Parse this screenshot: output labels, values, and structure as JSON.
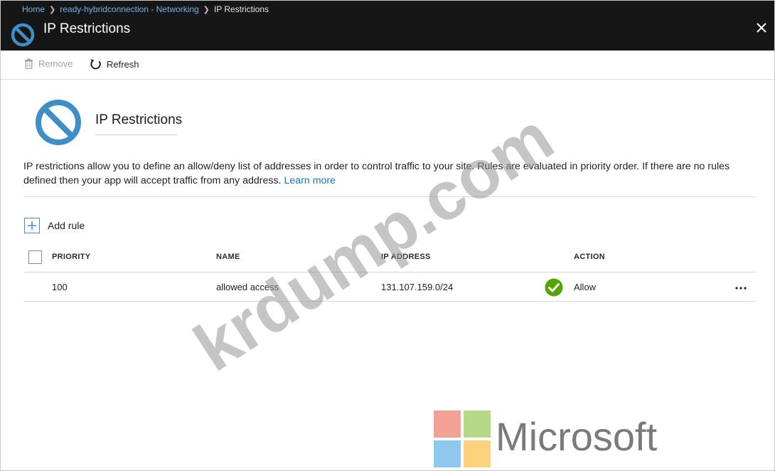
{
  "breadcrumb": {
    "home": "Home",
    "parent": "ready-hybridconnection - Networking",
    "current": "IP Restrictions"
  },
  "blade": {
    "title": "IP Restrictions",
    "icon": "blocked-circle-icon",
    "close_icon": "close-icon"
  },
  "toolbar": {
    "remove_label": "Remove",
    "remove_icon": "trash-icon",
    "refresh_label": "Refresh",
    "refresh_icon": "refresh-icon"
  },
  "content": {
    "title": "IP Restrictions",
    "description": "IP restrictions allow you to define an allow/deny list of addresses in order to control traffic to your site. Rules are evaluated in priority order. If there are no rules defined then your app will accept traffic from any address.",
    "learn_more": "Learn more"
  },
  "add_rule": {
    "label": "Add rule",
    "icon": "plus-icon"
  },
  "table": {
    "columns": {
      "priority": "PRIORITY",
      "name": "NAME",
      "ip_address": "IP ADDRESS",
      "action": "ACTION"
    },
    "rows": [
      {
        "priority": "100",
        "name": "allowed access",
        "ip_address": "131.107.159.0/24",
        "action": "Allow",
        "action_icon": "check-circle-icon"
      }
    ]
  },
  "watermark": {
    "text": "krdump.com",
    "logo_text": "Microsoft"
  },
  "colors": {
    "header_bg": "#161616",
    "link": "#1a73c7",
    "breadcrumb_link": "#6fb4ea",
    "allow_green": "#57a300",
    "blocked_blue": "#3e8fc7",
    "ms_red": "#f25022",
    "ms_green": "#7fba00",
    "ms_blue": "#00a4ef",
    "ms_yellow": "#ffb900"
  }
}
